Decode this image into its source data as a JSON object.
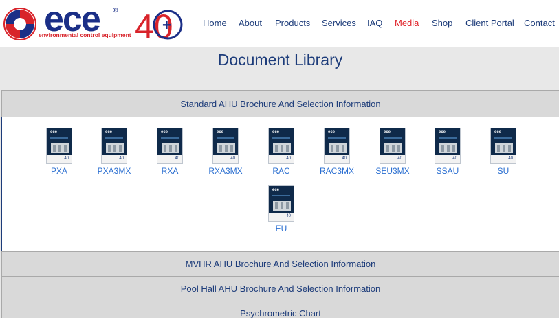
{
  "brand": {
    "wordmark": "ece",
    "registered": "®",
    "tagline": "environmental control equipment",
    "anniversary": "40",
    "anniversary_plus": "+",
    "colors": {
      "navy": "#1b2f87",
      "red": "#d8232a"
    }
  },
  "nav": {
    "items": [
      {
        "label": "Home"
      },
      {
        "label": "About"
      },
      {
        "label": "Products"
      },
      {
        "label": "Services"
      },
      {
        "label": "IAQ"
      },
      {
        "label": "Media",
        "active": true
      },
      {
        "label": "Shop"
      },
      {
        "label": "Client Portal"
      },
      {
        "label": "Contact"
      }
    ],
    "active_color": "#e0242b",
    "text_color": "#1d3c7a"
  },
  "page": {
    "title": "Document Library"
  },
  "sections": [
    {
      "title": "Standard AHU Brochure And Selection Information",
      "expanded": true,
      "documents": [
        {
          "label": "PXA"
        },
        {
          "label": "PXA3MX"
        },
        {
          "label": "RXA"
        },
        {
          "label": "RXA3MX"
        },
        {
          "label": "RAC"
        },
        {
          "label": "RAC3MX"
        },
        {
          "label": "SEU3MX"
        },
        {
          "label": "SSAU"
        },
        {
          "label": "SU"
        },
        {
          "label": "EU"
        }
      ]
    },
    {
      "title": "MVHR AHU Brochure And Selection Information",
      "expanded": false
    },
    {
      "title": "Pool Hall AHU Brochure And Selection Information",
      "expanded": false
    },
    {
      "title": "Psychrometric Chart",
      "expanded": false
    }
  ],
  "thumbnail": {
    "logo_text": "ece",
    "footer_mark": "40",
    "icon": "brochure-cover-icon"
  }
}
